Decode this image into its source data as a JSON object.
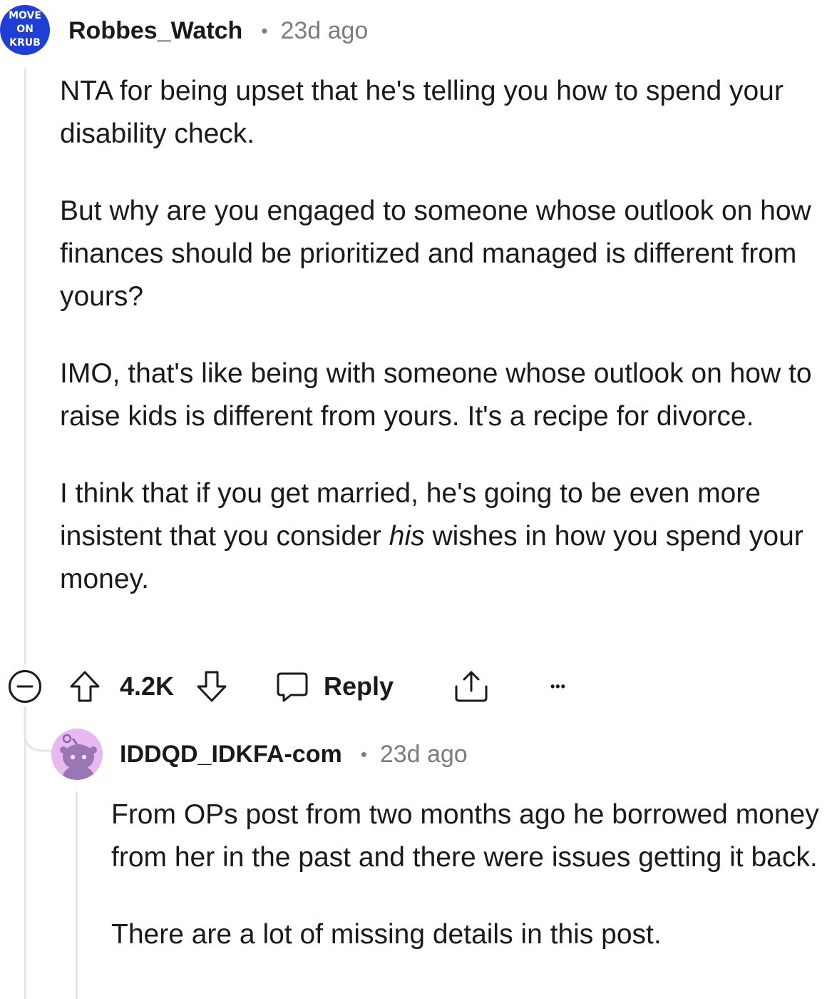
{
  "comment": {
    "avatar_text": [
      "MOVE",
      "ON",
      "KRUB"
    ],
    "username": "Robbes_Watch",
    "separator": "•",
    "time": "23d ago",
    "paragraphs": [
      "NTA for being upset that he's telling you how to spend your disability check.",
      "But why are you engaged to someone whose outlook on how finances should be prioritized and managed is different from yours?",
      "IMO, that's like being with someone whose outlook on how to raise kids is different from yours. It's a recipe for divorce."
    ],
    "last_paragraph": {
      "before": "I think that if you get married, he's going to be even more insistent that you consider ",
      "emphasis": "his",
      "after": " wishes in how you spend your money."
    },
    "actions": {
      "score": "4.2K",
      "reply_label": "Reply",
      "more_label": "•••"
    }
  },
  "reply": {
    "username": "IDDQD_IDKFA-com",
    "separator": "•",
    "time": "23d ago",
    "paragraphs": [
      "From OPs post from two months ago he borrowed money from her in the past and there were issues getting it back.",
      "There are a lot of missing details in this post."
    ]
  },
  "colors": {
    "text": "#1a1a1b",
    "meta": "#7c7c7c",
    "thread_line": "#e5e5e5",
    "badge_blue": "#1d3fd6",
    "snoo_bg": "#e9b7f2",
    "snoo_body": "#9b76b5"
  }
}
